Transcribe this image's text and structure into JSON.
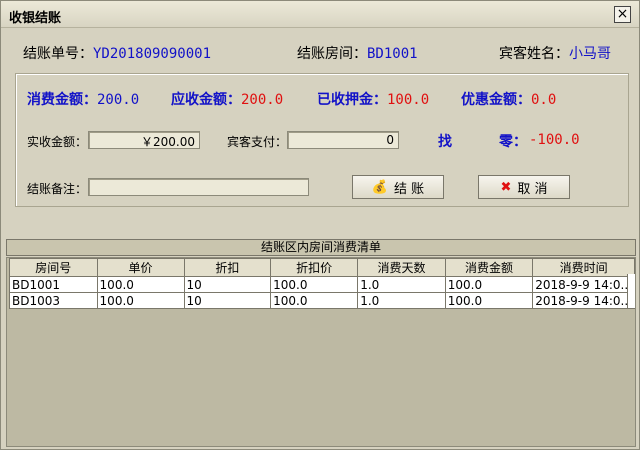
{
  "window": {
    "title": "收银结账"
  },
  "top": {
    "bill_no_label": "结账单号：",
    "bill_no": "YD201809090001",
    "room_label": "结账房间：",
    "room": "BD1001",
    "guest_label": "宾客姓名：",
    "guest": "小马哥"
  },
  "amounts": {
    "consume_label": "消费金额：",
    "consume": "200.0",
    "receivable_label": "应收金额：",
    "receivable": "200.0",
    "deposit_label": "已收押金：",
    "deposit": "100.0",
    "discount_label": "优惠金额：",
    "discount": "0.0"
  },
  "form": {
    "actual_label": "实收金额：",
    "actual_value": "￥200.00",
    "guest_pay_label": "宾客支付：",
    "guest_pay_value": "0",
    "find_label": "找",
    "change_label": "零：",
    "change_value": "-100.0",
    "note_label": "结账备注：",
    "note_value": ""
  },
  "buttons": {
    "checkout": "结 账",
    "cancel": "取 消"
  },
  "table": {
    "title": "结账区内房间消费清单",
    "columns": [
      "房间号",
      "单价",
      "折扣",
      "折扣价",
      "消费天数",
      "消费金额",
      "消费时间"
    ],
    "rows": [
      [
        "BD1001",
        "100.0",
        "10",
        "100.0",
        "1.0",
        "100.0",
        "2018-9-9 14:0..."
      ],
      [
        "BD1003",
        "100.0",
        "10",
        "100.0",
        "1.0",
        "100.0",
        "2018-9-9 14:0..."
      ]
    ]
  }
}
